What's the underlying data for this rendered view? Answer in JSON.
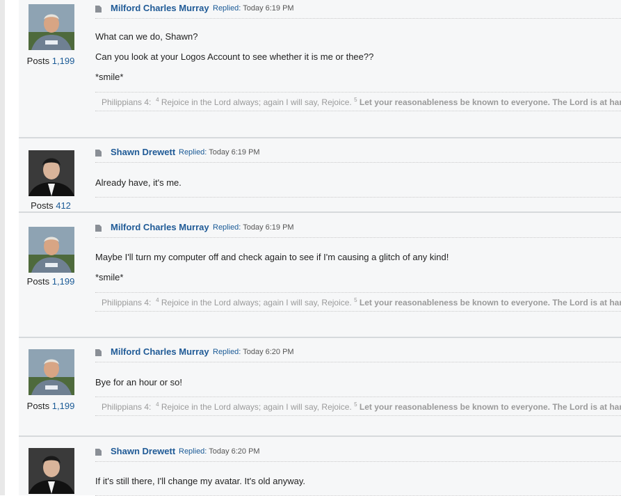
{
  "posts": [
    {
      "author": "Milford Charles Murray",
      "replied_label": "Replied:",
      "time": "Today 6:19 PM",
      "posts_label": "Posts",
      "posts_count": "1,199",
      "lines": [
        "What can we do, Shawn?",
        "Can you look at your Logos Account to see whether it is me or thee??",
        "*smile*"
      ],
      "signature": {
        "ref": "Philippians 4:",
        "v4": "4",
        "text4": "Rejoice in the Lord always; again I will say, Rejoice.",
        "v5": "5",
        "text5": "Let your reasonableness be known to everyone. The Lord is at hand"
      }
    },
    {
      "author": "Shawn Drewett",
      "replied_label": "Replied:",
      "time": "Today 6:19 PM",
      "posts_label": "Posts",
      "posts_count": "412",
      "lines": [
        "Already have, it's me."
      ]
    },
    {
      "author": "Milford Charles Murray",
      "replied_label": "Replied:",
      "time": "Today 6:19 PM",
      "posts_label": "Posts",
      "posts_count": "1,199",
      "lines": [
        "Maybe I'll turn my computer off and check again to see if I'm causing a glitch of any kind!",
        "*smile*"
      ],
      "signature": {
        "ref": "Philippians 4:",
        "v4": "4",
        "text4": "Rejoice in the Lord always; again I will say, Rejoice.",
        "v5": "5",
        "text5": "Let your reasonableness be known to everyone. The Lord is at hand"
      }
    },
    {
      "author": "Milford Charles Murray",
      "replied_label": "Replied:",
      "time": "Today 6:20 PM",
      "posts_label": "Posts",
      "posts_count": "1,199",
      "lines": [
        "Bye for an hour or so!"
      ],
      "signature": {
        "ref": "Philippians 4:",
        "v4": "4",
        "text4": "Rejoice in the Lord always; again I will say, Rejoice.",
        "v5": "5",
        "text5": "Let your reasonableness be known to everyone. The Lord is at hand"
      }
    },
    {
      "author": "Shawn Drewett",
      "replied_label": "Replied:",
      "time": "Today 6:20 PM",
      "lines": [
        "If it's still there, I'll change my avatar. It's old anyway."
      ]
    }
  ],
  "icons": {
    "post": "post-page-icon",
    "avatar_milford": "avatar-milford",
    "avatar_shawn": "avatar-shawn"
  },
  "colors": {
    "link": "#1f5a96",
    "post_bg": "#f6f7f8",
    "divider": "#d6d9dc"
  }
}
